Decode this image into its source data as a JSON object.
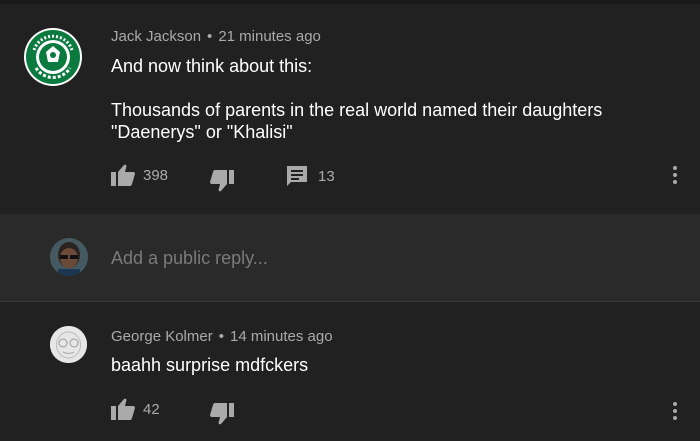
{
  "comments": [
    {
      "author": "Jack Jackson",
      "time": "21 minutes ago",
      "text": "And now think about this:\n\nThousands of parents in the real world named their daughters\n\"Daenerys\" or \"Khalisi\"",
      "likes": "398",
      "replies": "13",
      "avatar_text": "DUNA STARBUCKS COFFEE"
    },
    {
      "author": "George Kolmer",
      "time": "14 minutes ago",
      "text": "baahh surprise mdfckers",
      "likes": "42"
    }
  ],
  "reply": {
    "placeholder": "Add a public reply..."
  },
  "colors": {
    "background": "#212121",
    "reply_bar": "#2a2a2a",
    "secondary_text": "#aaaaaa",
    "starbucks_green": "#0a7a3e"
  },
  "icons": [
    "thumbs-up-icon",
    "thumbs-down-icon",
    "comment-icon",
    "more-vert-icon"
  ]
}
